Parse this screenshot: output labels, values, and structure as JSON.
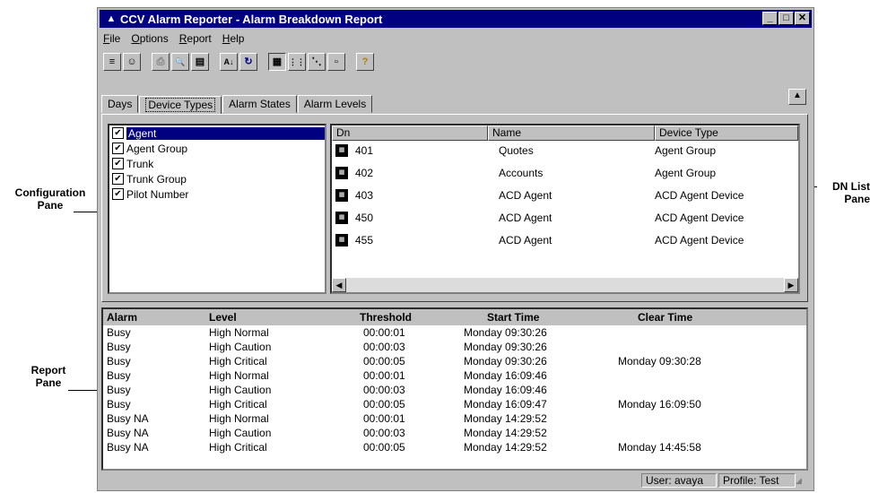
{
  "window": {
    "title": "CCV Alarm Reporter - Alarm Breakdown Report",
    "controls": [
      "minimize-icon",
      "maximize-icon",
      "close-icon"
    ]
  },
  "menu": [
    {
      "label": "File",
      "mnemonic": "F",
      "rest": "ile"
    },
    {
      "label": "Options",
      "mnemonic": "O",
      "rest": "ptions"
    },
    {
      "label": "Report",
      "mnemonic": "R",
      "rest": "eport"
    },
    {
      "label": "Help",
      "mnemonic": "H",
      "rest": "elp"
    }
  ],
  "toolbar": {
    "buttons": [
      "print-settings-icon",
      "user-icon",
      "print-icon",
      "print-preview-icon",
      "report-icon",
      "sort-icon",
      "refresh-icon",
      "large-icons-icon",
      "small-icons-icon",
      "list-icon",
      "details-icon",
      "help-icon"
    ],
    "glyphs": [
      "≡",
      "☺",
      "⎙",
      "🔍",
      "▤",
      "A↓",
      "↻",
      "▦",
      "⋮⋮",
      "⋱",
      "▫",
      "?"
    ]
  },
  "tabs": [
    "Days",
    "Device Types",
    "Alarm States",
    "Alarm Levels"
  ],
  "active_tab": "Device Types",
  "config_items": [
    {
      "label": "Agent",
      "checked": true,
      "selected": true
    },
    {
      "label": "Agent Group",
      "checked": true,
      "selected": false
    },
    {
      "label": "Trunk",
      "checked": true,
      "selected": false
    },
    {
      "label": "Trunk Group",
      "checked": true,
      "selected": false
    },
    {
      "label": "Pilot Number",
      "checked": true,
      "selected": false
    }
  ],
  "dn_list": {
    "columns": [
      "Dn",
      "Name",
      "Device Type"
    ],
    "rows": [
      {
        "dn": "401",
        "name": "Quotes",
        "type": "Agent Group"
      },
      {
        "dn": "402",
        "name": "Accounts",
        "type": "Agent Group"
      },
      {
        "dn": "403",
        "name": "ACD Agent",
        "type": "ACD Agent Device"
      },
      {
        "dn": "450",
        "name": "ACD Agent",
        "type": "ACD Agent Device"
      },
      {
        "dn": "455",
        "name": "ACD Agent",
        "type": "ACD Agent Device"
      }
    ]
  },
  "report": {
    "columns": [
      "Alarm",
      "Level",
      "Threshold",
      "Start Time",
      "Clear Time"
    ],
    "rows": [
      {
        "alarm": "Busy",
        "level": "High Normal",
        "threshold": "00:00:01",
        "start": "Monday 09:30:26",
        "clear": ""
      },
      {
        "alarm": "Busy",
        "level": "High Caution",
        "threshold": "00:00:03",
        "start": "Monday 09:30:26",
        "clear": ""
      },
      {
        "alarm": "Busy",
        "level": "High Critical",
        "threshold": "00:00:05",
        "start": "Monday 09:30:26",
        "clear": "Monday 09:30:28"
      },
      {
        "alarm": "Busy",
        "level": "High Normal",
        "threshold": "00:00:01",
        "start": "Monday 16:09:46",
        "clear": ""
      },
      {
        "alarm": "Busy",
        "level": "High Caution",
        "threshold": "00:00:03",
        "start": "Monday 16:09:46",
        "clear": ""
      },
      {
        "alarm": "Busy",
        "level": "High Critical",
        "threshold": "00:00:05",
        "start": "Monday 16:09:47",
        "clear": "Monday 16:09:50"
      },
      {
        "alarm": "Busy NA",
        "level": "High Normal",
        "threshold": "00:00:01",
        "start": "Monday 14:29:52",
        "clear": ""
      },
      {
        "alarm": "Busy NA",
        "level": "High Caution",
        "threshold": "00:00:03",
        "start": "Monday 14:29:52",
        "clear": ""
      },
      {
        "alarm": "Busy NA",
        "level": "High Critical",
        "threshold": "00:00:05",
        "start": "Monday 14:29:52",
        "clear": "Monday 14:45:58"
      }
    ]
  },
  "status": {
    "user": "User: avaya",
    "profile": "Profile: Test"
  },
  "callouts": {
    "config": [
      "Configuration",
      "Pane"
    ],
    "dnlist": [
      "DN List",
      "Pane"
    ],
    "report": [
      "Report",
      "Pane"
    ]
  },
  "colors": {
    "titlebar": "#000080",
    "selection": "#000080",
    "face": "#c0c0c0"
  }
}
